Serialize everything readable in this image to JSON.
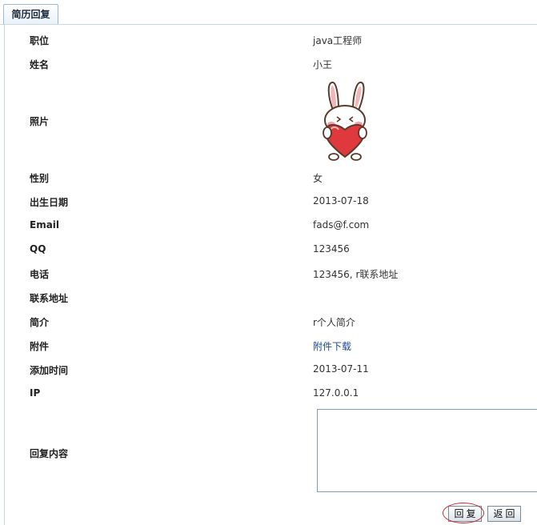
{
  "tab": {
    "label": "简历回复"
  },
  "fields": {
    "position": {
      "label": "职位",
      "value": "java工程师"
    },
    "name": {
      "label": "姓名",
      "value": "小王"
    },
    "photo": {
      "label": "照片"
    },
    "gender": {
      "label": "性别",
      "value": "女"
    },
    "birthdate": {
      "label": "出生日期",
      "value": "2013-07-18"
    },
    "email": {
      "label": "Email",
      "value": "fads@f.com"
    },
    "qq": {
      "label": "QQ",
      "value": "123456"
    },
    "phone": {
      "label": "电话",
      "value": "123456, r联系地址"
    },
    "address": {
      "label": "联系地址",
      "value": ""
    },
    "intro": {
      "label": "简介",
      "value": "r个人简介"
    },
    "attachment": {
      "label": "附件",
      "value": "附件下载"
    },
    "added_time": {
      "label": "添加时间",
      "value": "2013-07-11"
    },
    "ip": {
      "label": "IP",
      "value": "127.0.0.1"
    },
    "reply": {
      "label": "回复内容",
      "value": ""
    }
  },
  "buttons": {
    "reply": "回复",
    "back": "返回"
  },
  "colors": {
    "annotation_circle": "#c0303a",
    "link": "#1c4a8a"
  }
}
